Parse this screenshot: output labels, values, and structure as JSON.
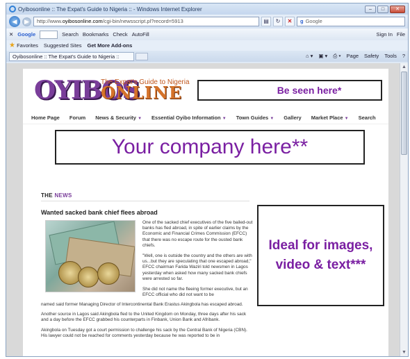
{
  "browser": {
    "title": "Oyibosonline :: The Expat's Guide to Nigeria :: - Windows Internet Explorer",
    "address_prefix": "http://www.",
    "address_domain": "oyibosonline.com",
    "address_path": "/cgi-bin/newsscript.pl?record=5913",
    "search_placeholder": "Google",
    "google_label": "Google",
    "toolbar": {
      "search": "Search",
      "bookmarks": "Bookmarks",
      "check": "Check",
      "autofill": "AutoFill",
      "signin": "Sign In",
      "file": "File"
    },
    "favorites": "Favorites",
    "suggested_sites": "Suggested Sites",
    "get_addons": "Get More Add-ons",
    "tab_title": "Oyibosonline :: The Expat's Guide to Nigeria ::",
    "commands": [
      "Page",
      "Safety",
      "Tools"
    ]
  },
  "site": {
    "logo_main": "OYIBOS",
    "logo_online": "ONLINE",
    "tagline": "The Expat's Guide to Nigeria",
    "banner_ad": "Be seen here*",
    "nav": [
      {
        "label": "Home Page",
        "arrow": ""
      },
      {
        "label": "Forum",
        "arrow": ""
      },
      {
        "label": "News & Security",
        "arrow": "▼"
      },
      {
        "label": "Essential Oyibo Information",
        "arrow": "▼"
      },
      {
        "label": "Town Guides",
        "arrow": "▼"
      },
      {
        "label": "Gallery",
        "arrow": ""
      },
      {
        "label": "Market Place",
        "arrow": "▼"
      },
      {
        "label": "Search",
        "arrow": ""
      }
    ],
    "leader_ad": "Your company here**",
    "side_ad": "Ideal for images, video & text***",
    "news_label_the": "THE",
    "news_label_news": "NEWS",
    "headline": "Wanted sacked bank chief flees abroad",
    "col_paragraphs": [
      "One of the sacked chief executives of the five bailed-out banks has fled abroad, in spite of earlier claims by the Economic and Financial Crimes Commission (EFCC) that there was no escape route for the ousted bank chiefs.",
      "\"Well, one is outside the country and the others are with us...but they are speculating that one escaped abroad,\" EFCC chairman Farida Waziri told newsmen in Lagos yesterday when asked how many sacked bank chiefs were arrested so far.",
      "She did not name the fleeing former executive, but an EFCC official who did not want to be"
    ],
    "full_paragraphs": [
      "named said former Managing Director of Intercontinental Bank Erastus Akingbola has escaped abroad.",
      "Another source in Lagos said Akingbola fled to the United Kingdom on Monday, three days after his sack and a day before the EFCC grabbed his counterparts in Finbank, Union Bank and Afribank.",
      "Akingbola on Tuesday got a court permission to challenge his sack by the Central Bank of Nigeria (CBN). His lawyer could not be reached for comments yesterday because he was reported to be in"
    ]
  }
}
